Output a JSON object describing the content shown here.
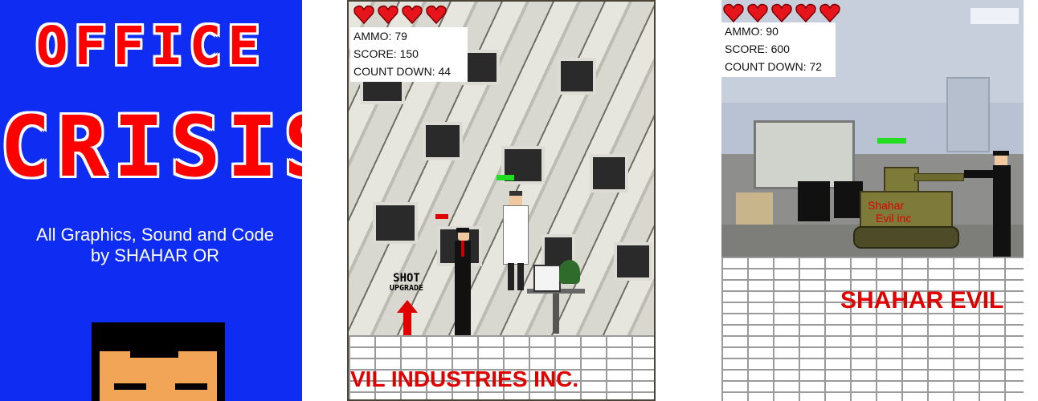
{
  "title_screen": {
    "title_line1": "OFFICE",
    "title_line2": "CRISIS",
    "credits_line1": "All Graphics, Sound and Code",
    "credits_line2": "by SHAHAR OR"
  },
  "level1": {
    "hearts": 4,
    "hud": {
      "ammo": "AMMO: 79",
      "score": "SCORE: 150",
      "countdown": "COUNT DOWN: 44"
    },
    "powerup_line1": "SHOT",
    "powerup_line2": "UPGRADE",
    "floor_text": "VIL  INDUSTRIES INC."
  },
  "level2": {
    "hearts": 5,
    "hud": {
      "ammo": "AMMO: 90",
      "score": "SCORE: 600",
      "countdown": "COUNT DOWN: 72"
    },
    "tank_label_line1": "Shahar",
    "tank_label_line2": "Evil inc",
    "wall_text": "SHAHAR EVIL"
  },
  "colors": {
    "title_bg": "#0f2cf2",
    "title_red": "#ff0000",
    "heart_red": "#e8141c",
    "health_green": "#22dd22",
    "tank_olive": "#7d7a3a"
  }
}
